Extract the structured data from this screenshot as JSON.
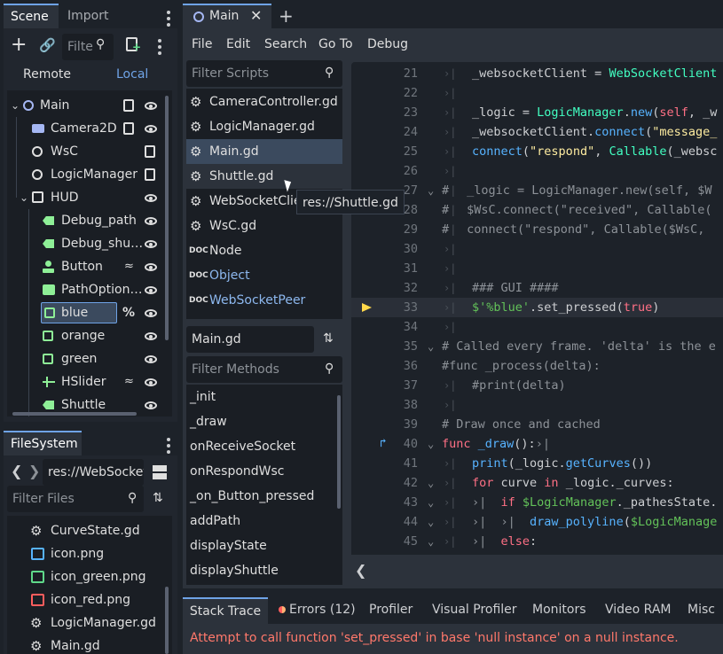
{
  "scene_dock": {
    "tabs": [
      "Scene",
      "Import"
    ],
    "filter_placeholder": "Filte",
    "remote_label": "Remote",
    "local_label": "Local",
    "tree": [
      {
        "label": "Main",
        "indent": 0,
        "icon": "node2d-circle-icon",
        "script": true,
        "eye": true
      },
      {
        "label": "Camera2D",
        "indent": 1,
        "icon": "camera-icon",
        "script": true,
        "eye": true
      },
      {
        "label": "WsC",
        "indent": 1,
        "icon": "node-circle-icon",
        "script": true,
        "eye": false
      },
      {
        "label": "LogicManager",
        "indent": 1,
        "icon": "node-circle-icon",
        "script": true,
        "eye": false
      },
      {
        "label": "HUD",
        "indent": 1,
        "icon": "canvas-layer-icon",
        "script": false,
        "eye": true
      },
      {
        "label": "Debug_path",
        "indent": 2,
        "icon": "label-icon",
        "script": false,
        "eye": true
      },
      {
        "label": "Debug_shu…",
        "indent": 2,
        "icon": "label-icon",
        "script": false,
        "eye": true
      },
      {
        "label": "Button",
        "indent": 2,
        "icon": "button-icon",
        "script": false,
        "eye": true
      },
      {
        "label": "PathOption…",
        "indent": 2,
        "icon": "option-button-icon",
        "script": false,
        "eye": true
      },
      {
        "label": "blue",
        "indent": 2,
        "icon": "checkbox-icon",
        "script": false,
        "eye": true,
        "unique": "%"
      },
      {
        "label": "orange",
        "indent": 2,
        "icon": "checkbox-icon",
        "script": false,
        "eye": true
      },
      {
        "label": "green",
        "indent": 2,
        "icon": "checkbox-icon",
        "script": false,
        "eye": true
      },
      {
        "label": "HSlider",
        "indent": 2,
        "icon": "hslider-icon",
        "script": false,
        "eye": true
      },
      {
        "label": "Shuttle",
        "indent": 2,
        "icon": "label-icon",
        "script": false,
        "eye": true
      }
    ]
  },
  "filesystem": {
    "tab": "FileSystem",
    "path": "res://WebSocket",
    "filter_placeholder": "Filter Files",
    "files": [
      {
        "label": "CurveState.gd",
        "icon": "gear-icon"
      },
      {
        "label": "icon.png",
        "icon": "image-icon-blue"
      },
      {
        "label": "icon_green.png",
        "icon": "image-icon-green"
      },
      {
        "label": "icon_red.png",
        "icon": "image-icon-red"
      },
      {
        "label": "LogicManager.gd",
        "icon": "gear-icon"
      },
      {
        "label": "Main.gd",
        "icon": "gear-icon"
      }
    ]
  },
  "editor": {
    "tab_label": "Main",
    "menu": [
      "File",
      "Edit",
      "Search",
      "Go To",
      "Debug"
    ],
    "filter_scripts_placeholder": "Filter Scripts",
    "scripts": [
      {
        "label": "CameraController.gd",
        "icon": "gear-icon",
        "doc": false
      },
      {
        "label": "LogicManager.gd",
        "icon": "gear-icon",
        "doc": false
      },
      {
        "label": "Main.gd",
        "icon": "gear-icon",
        "doc": false,
        "selected": true
      },
      {
        "label": "Shuttle.gd",
        "icon": "gear-icon",
        "doc": false,
        "hover": true
      },
      {
        "label": "WebSocketClie",
        "icon": "gear-icon",
        "doc": false
      },
      {
        "label": "WsC.gd",
        "icon": "gear-icon",
        "doc": false
      },
      {
        "label": "Node",
        "icon": "doc-icon",
        "doc": true
      },
      {
        "label": "Object",
        "icon": "doc-icon",
        "doc": true,
        "blue": true
      },
      {
        "label": "WebSocketPeer",
        "icon": "doc-icon",
        "doc": true,
        "blue": true
      }
    ],
    "tooltip": "res://Shuttle.gd",
    "current_script": "Main.gd",
    "filter_methods_placeholder": "Filter Methods",
    "methods": [
      "_init",
      "_draw",
      "onReceiveSocket",
      "onRespondWsc",
      "_on_Button_pressed",
      "addPath",
      "displayState",
      "displayShuttle"
    ],
    "code_lines": [
      {
        "n": "21",
        "html": "<span class='def'>_websocketClient = </span><span class='cls'>WebSocketClient</span>"
      },
      {
        "n": "22",
        "html": ""
      },
      {
        "n": "23",
        "html": "<span class='def'>_logic = </span><span class='cls'>LogicManager</span><span class='def'>.</span><span class='fn'>new</span><span class='def'>(</span><span class='kw'>self</span><span class='def'>, _w</span>"
      },
      {
        "n": "24",
        "html": "<span class='def'>_websocketClient.</span><span class='fn'>connect</span><span class='def'>(</span><span class='str'>\"message_</span>"
      },
      {
        "n": "25",
        "html": "<span class='fn'>connect</span><span class='def'>(</span><span class='str'>\"respond\"</span><span class='def'>, </span><span class='cls'>Callable</span><span class='def'>(_websc</span>"
      },
      {
        "n": "26",
        "html": ""
      },
      {
        "n": "27",
        "html": "<span class='cmt'>_logic = LogicManager.new(self, $W</span>",
        "fold": true,
        "commented": true
      },
      {
        "n": "28",
        "html": "<span class='cmt'>$WsC.connect(\"received\", Callable(</span>",
        "commented": true
      },
      {
        "n": "29",
        "html": "<span class='cmt'>connect(\"respond\", Callable($WsC, </span>",
        "commented": true
      },
      {
        "n": "30",
        "html": ""
      },
      {
        "n": "31",
        "html": ""
      },
      {
        "n": "32",
        "html": "<span class='cmt'>### GUI ####</span>"
      },
      {
        "n": "33",
        "html": "<span class='node'>$'%blue'</span><span class='def'>.set_pressed(</span><span class='bool'>true</span><span class='def'>)</span>",
        "exec": true
      },
      {
        "n": "34",
        "html": ""
      },
      {
        "n": "35",
        "html": "<span class='cmt'># Called every frame. 'delta' is the e</span>",
        "fold": true,
        "noindent": true
      },
      {
        "n": "36",
        "html": "<span class='cmt'>#func _process(delta):</span>",
        "noindent": true
      },
      {
        "n": "37",
        "html": "<span class='cmt'>#print(delta)</span>"
      },
      {
        "n": "38",
        "html": ""
      },
      {
        "n": "39",
        "html": "<span class='cmt'># Draw once and cached</span>",
        "noindent": true
      },
      {
        "n": "40",
        "html": "<span class='kw'>func</span><span class='def'> </span><span class='fn'>_draw</span><span class='def'>():</span><span class='cmt'>&#8250;|</span>",
        "fold": true,
        "noindent": true,
        "override": true
      },
      {
        "n": "41",
        "html": "<span class='fn'>print</span><span class='def'>(_logic.</span><span class='fn'>getCurves</span><span class='def'>())</span>"
      },
      {
        "n": "42",
        "html": "<span class='kw'>for</span><span class='def'> curve </span><span class='kw'>in</span><span class='def'> _logic._curves:</span>",
        "fold": true
      },
      {
        "n": "43",
        "html": "<span class='cmt'>&#8250;|  </span><span class='kw'>if</span><span class='def'> </span><span class='node'>$LogicManager</span><span class='def'>._pathesState.</span>",
        "fold": true
      },
      {
        "n": "44",
        "html": "<span class='cmt'>&#8250;|  &#8250;|  </span><span class='fn'>draw_polyline</span><span class='def'>(</span><span class='node'>$LogicManage</span>",
        "fold": true
      },
      {
        "n": "45",
        "html": "<span class='cmt'>&#8250;|  </span><span class='kw'>else</span><span class='def'>:</span>",
        "fold": true
      }
    ]
  },
  "bottom_panel": {
    "tabs": [
      "Stack Trace",
      "Errors (12)",
      "Profiler",
      "Visual Profiler",
      "Monitors",
      "Video RAM",
      "Misc"
    ],
    "error_message": "Attempt to call function 'set_pressed' in base 'null instance' on a null instance."
  },
  "colors": {
    "accent": "#6fa3e6",
    "error": "#ff786b",
    "selection": "#3b4a5e"
  }
}
